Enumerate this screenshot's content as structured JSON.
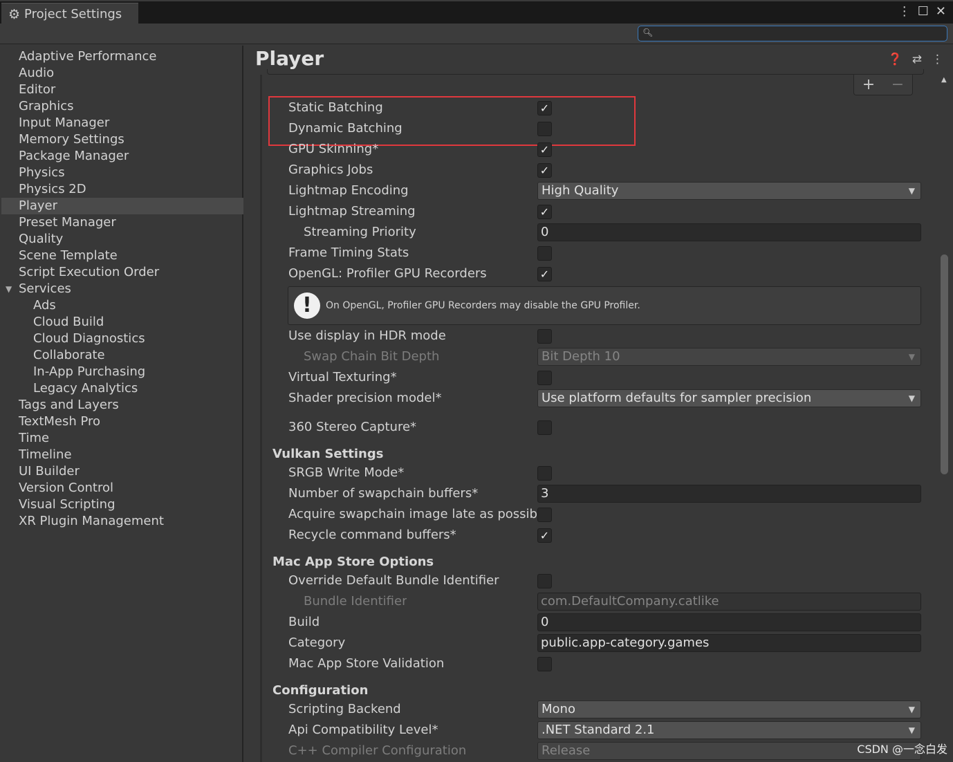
{
  "window": {
    "tab_title": "Project Settings",
    "controls": [
      "⋮",
      "☐",
      "✕"
    ]
  },
  "search": {
    "placeholder": ""
  },
  "sidebar": {
    "items": [
      {
        "label": "Adaptive Performance",
        "indent": 0
      },
      {
        "label": "Audio",
        "indent": 0
      },
      {
        "label": "Editor",
        "indent": 0
      },
      {
        "label": "Graphics",
        "indent": 0
      },
      {
        "label": "Input Manager",
        "indent": 0
      },
      {
        "label": "Memory Settings",
        "indent": 0
      },
      {
        "label": "Package Manager",
        "indent": 0
      },
      {
        "label": "Physics",
        "indent": 0
      },
      {
        "label": "Physics 2D",
        "indent": 0
      },
      {
        "label": "Player",
        "indent": 0,
        "selected": true
      },
      {
        "label": "Preset Manager",
        "indent": 0
      },
      {
        "label": "Quality",
        "indent": 0
      },
      {
        "label": "Scene Template",
        "indent": 0
      },
      {
        "label": "Script Execution Order",
        "indent": 0
      },
      {
        "label": "Services",
        "indent": 0,
        "expanded": true
      },
      {
        "label": "Ads",
        "indent": 1
      },
      {
        "label": "Cloud Build",
        "indent": 1
      },
      {
        "label": "Cloud Diagnostics",
        "indent": 1
      },
      {
        "label": "Collaborate",
        "indent": 1
      },
      {
        "label": "In-App Purchasing",
        "indent": 1
      },
      {
        "label": "Legacy Analytics",
        "indent": 1
      },
      {
        "label": "Tags and Layers",
        "indent": 0
      },
      {
        "label": "TextMesh Pro",
        "indent": 0
      },
      {
        "label": "Time",
        "indent": 0
      },
      {
        "label": "Timeline",
        "indent": 0
      },
      {
        "label": "UI Builder",
        "indent": 0
      },
      {
        "label": "Version Control",
        "indent": 0
      },
      {
        "label": "Visual Scripting",
        "indent": 0
      },
      {
        "label": "XR Plugin Management",
        "indent": 0
      }
    ]
  },
  "main": {
    "title": "Player",
    "header_icons": [
      "help-icon",
      "preset-icon",
      "more-icon"
    ],
    "list_buttons": {
      "add": "+",
      "remove": "−"
    },
    "help_message": "On OpenGL, Profiler GPU Recorders may disable the GPU Profiler.",
    "sections": {
      "vulkan": "Vulkan Settings",
      "mac": "Mac App Store Options",
      "config": "Configuration"
    },
    "rows": {
      "static_batching": {
        "label": "Static Batching",
        "checked": true
      },
      "dynamic_batching": {
        "label": "Dynamic Batching",
        "checked": false
      },
      "gpu_skinning": {
        "label": "GPU Skinning*",
        "checked": true
      },
      "graphics_jobs": {
        "label": "Graphics Jobs",
        "checked": true
      },
      "lightmap_encoding": {
        "label": "Lightmap Encoding",
        "value": "High Quality"
      },
      "lightmap_streaming": {
        "label": "Lightmap Streaming",
        "checked": true
      },
      "streaming_priority": {
        "label": "Streaming Priority",
        "value": "0"
      },
      "frame_timing": {
        "label": "Frame Timing Stats",
        "checked": false
      },
      "opengl_profiler": {
        "label": "OpenGL: Profiler GPU Recorders",
        "checked": true
      },
      "hdr_display": {
        "label": "Use display in HDR mode",
        "checked": false
      },
      "swap_chain": {
        "label": "Swap Chain Bit Depth",
        "value": "Bit Depth 10"
      },
      "virtual_texturing": {
        "label": "Virtual Texturing*",
        "checked": false
      },
      "shader_precision": {
        "label": "Shader precision model*",
        "value": "Use platform defaults for sampler precision"
      },
      "stereo_capture": {
        "label": "360 Stereo Capture*",
        "checked": false
      },
      "srgb_write": {
        "label": "SRGB Write Mode*",
        "checked": false
      },
      "swapchain_buffers": {
        "label": "Number of swapchain buffers*",
        "value": "3"
      },
      "acquire_late": {
        "label": "Acquire swapchain image late as possible",
        "checked": false
      },
      "recycle_buffers": {
        "label": "Recycle command buffers*",
        "checked": true
      },
      "override_bundle": {
        "label": "Override Default Bundle Identifier",
        "checked": false
      },
      "bundle_id": {
        "label": "Bundle Identifier",
        "value": "com.DefaultCompany.catlike"
      },
      "build": {
        "label": "Build",
        "value": "0"
      },
      "category": {
        "label": "Category",
        "value": "public.app-category.games"
      },
      "mac_validation": {
        "label": "Mac App Store Validation",
        "checked": false
      },
      "scripting_backend": {
        "label": "Scripting Backend",
        "value": "Mono"
      },
      "api_level": {
        "label": "Api Compatibility Level*",
        "value": ".NET Standard 2.1"
      },
      "cpp_config": {
        "label": "C++ Compiler Configuration",
        "value": "Release"
      }
    }
  },
  "watermark": "CSDN @一念白发",
  "colors": {
    "highlight_box": "#e0383d",
    "search_border": "#3a79bb",
    "selected_row": "#4a4a4a"
  }
}
